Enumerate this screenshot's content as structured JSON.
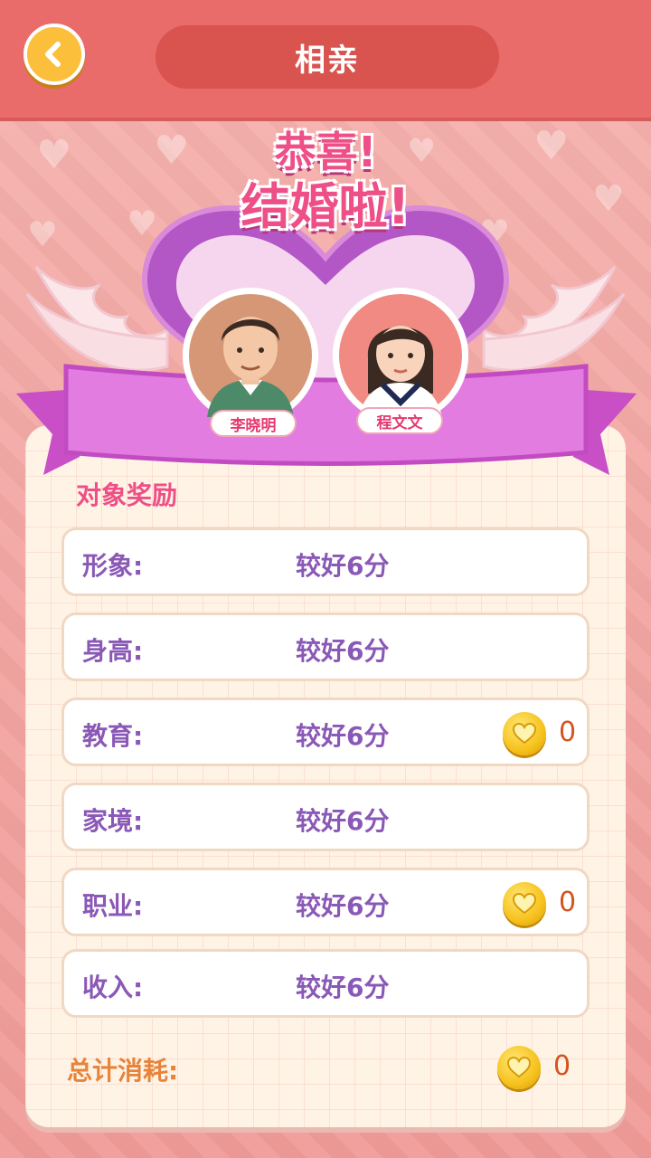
{
  "header": {
    "title": "相亲",
    "back_icon": "chevron-left-icon"
  },
  "banner": {
    "line1": "恭喜!",
    "line2": "结婚啦!",
    "groom_name": "李晓明",
    "bride_name": "程文文"
  },
  "rewards": {
    "title": "对象奖励",
    "rows": [
      {
        "label": "形象:",
        "value": "较好6分"
      },
      {
        "label": "身高:",
        "value": "较好6分"
      },
      {
        "label": "教育:",
        "value": "较好6分",
        "coin": "0"
      },
      {
        "label": "家境:",
        "value": "较好6分"
      },
      {
        "label": "职业:",
        "value": "较好6分",
        "coin": "0"
      },
      {
        "label": "收入:",
        "value": "较好6分"
      }
    ]
  },
  "total": {
    "label": "总计消耗:",
    "coin": "0"
  },
  "colors": {
    "header": "#e96b6a",
    "accent": "#ee4f87",
    "text": "#8a58b6",
    "coin": "#f6c21c"
  }
}
